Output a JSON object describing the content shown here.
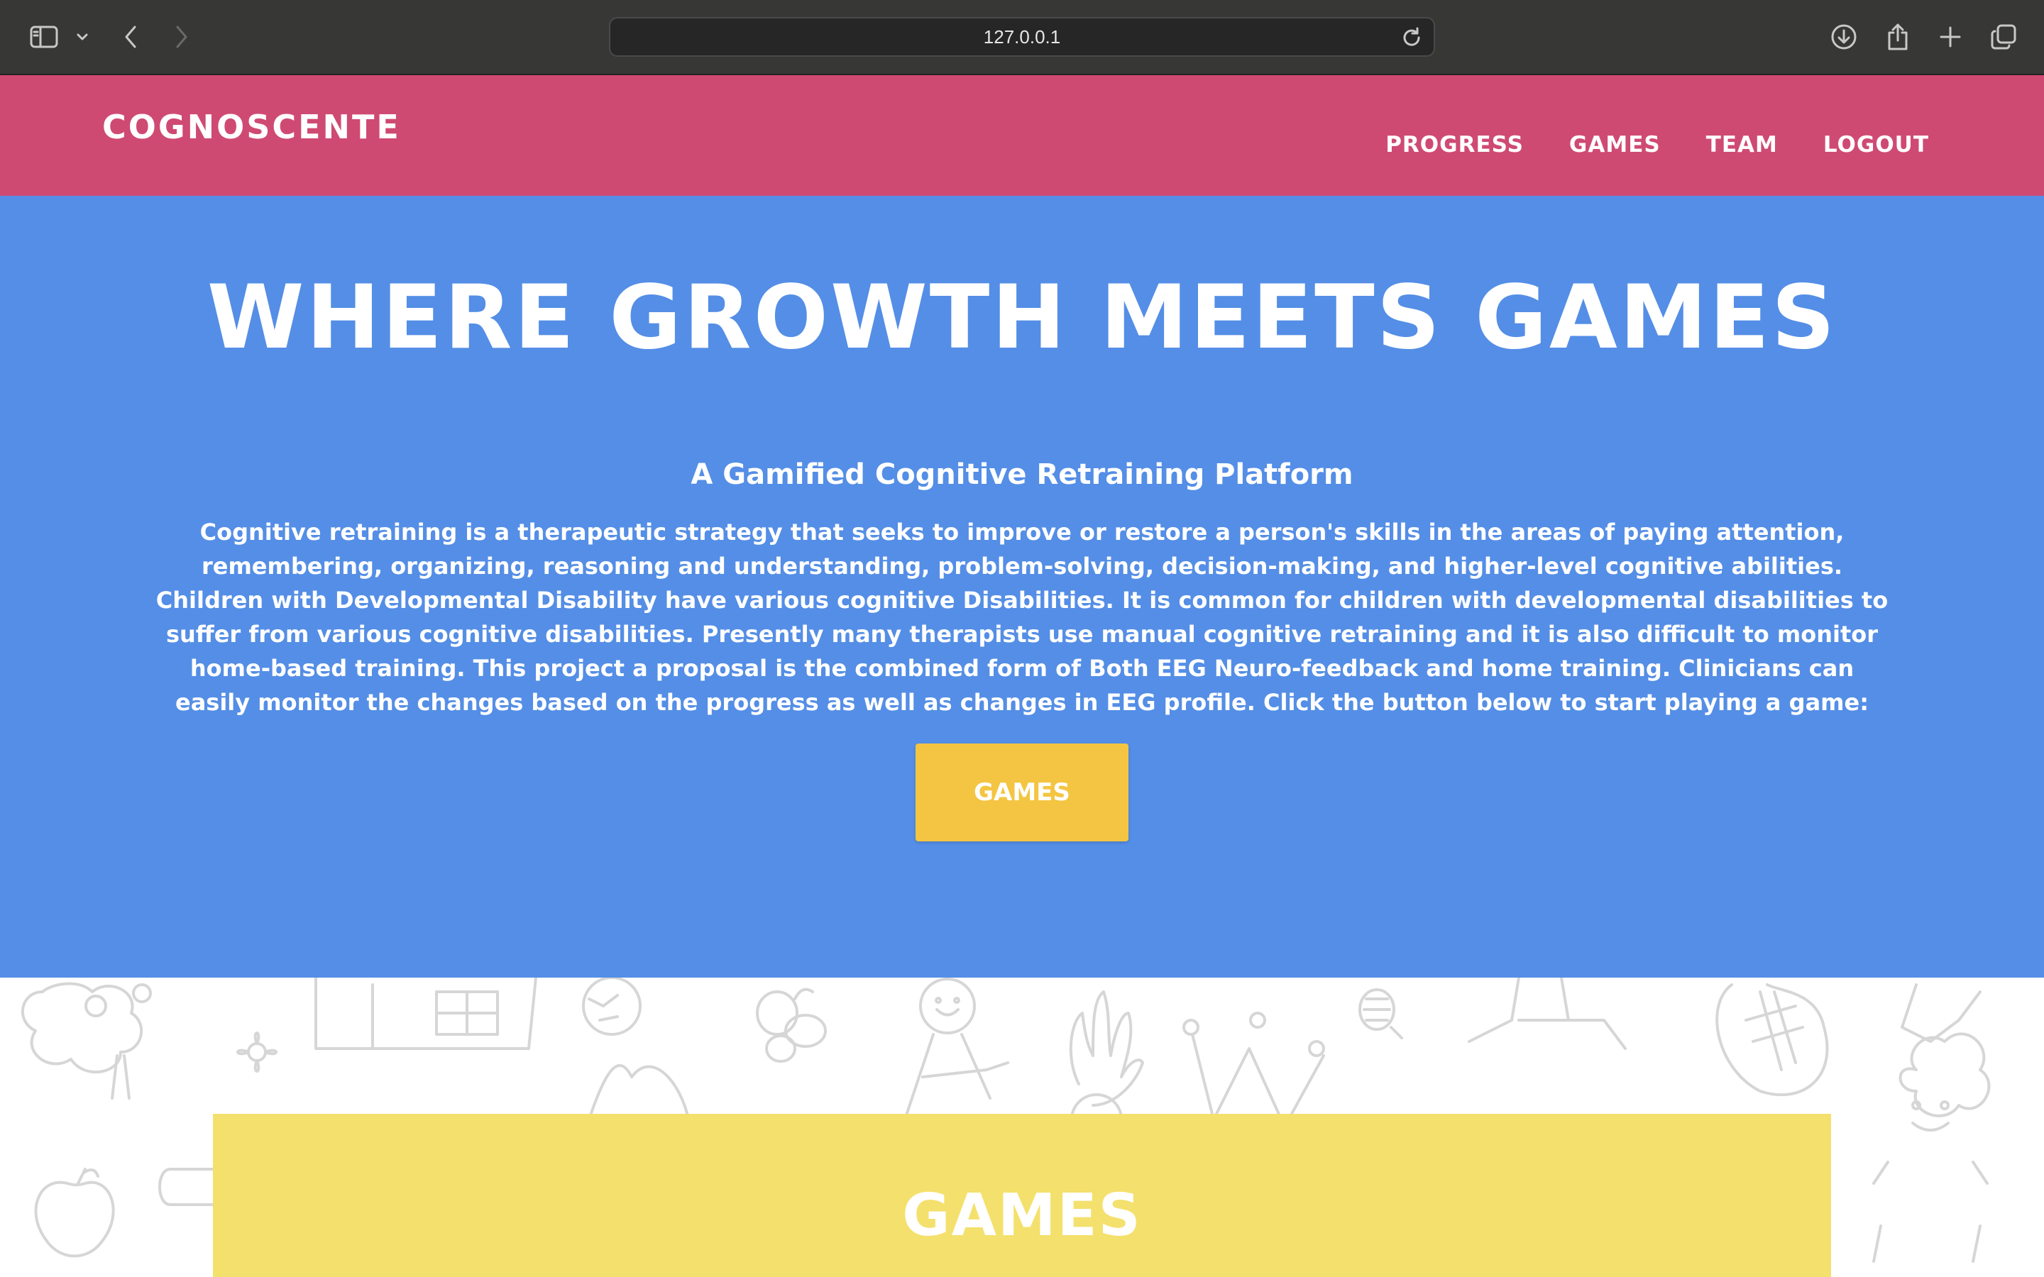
{
  "browser": {
    "url": "127.0.0.1"
  },
  "header": {
    "brand": "COGNOSCENTE",
    "nav": [
      "PROGRESS",
      "GAMES",
      "TEAM",
      "LOGOUT"
    ]
  },
  "hero": {
    "title": "WHERE GROWTH MEETS GAMES",
    "subtitle": "A Gamified Cognitive Retraining Platform",
    "description": "Cognitive retraining is a therapeutic strategy that seeks to improve or restore a person's skills in the areas of paying attention, remembering, organizing, reasoning and understanding, problem-solving, decision-making, and higher-level cognitive abilities. Children with Developmental Disability have various cognitive Disabilities. It is common for children with developmental disabilities to suffer from various cognitive disabilities. Presently many therapists use manual cognitive retraining and it is also difficult to monitor home-based training. This project a proposal is the combined form of Both EEG Neuro-feedback and home training. Clinicians can easily monitor the changes based on the progress as well as changes in EEG profile. Click the button below to start playing a game:",
    "cta_label": "GAMES"
  },
  "games_section": {
    "title": "GAMES"
  },
  "colors": {
    "header": "#cf4a73",
    "hero": "#548ee6",
    "cta": "#f4c542",
    "games_panel": "#f4e06c"
  },
  "icons": [
    "sidebar-icon",
    "chevron-down-icon",
    "back-icon",
    "forward-icon",
    "reload-icon",
    "download-icon",
    "share-icon",
    "new-tab-icon",
    "tab-overview-icon"
  ]
}
